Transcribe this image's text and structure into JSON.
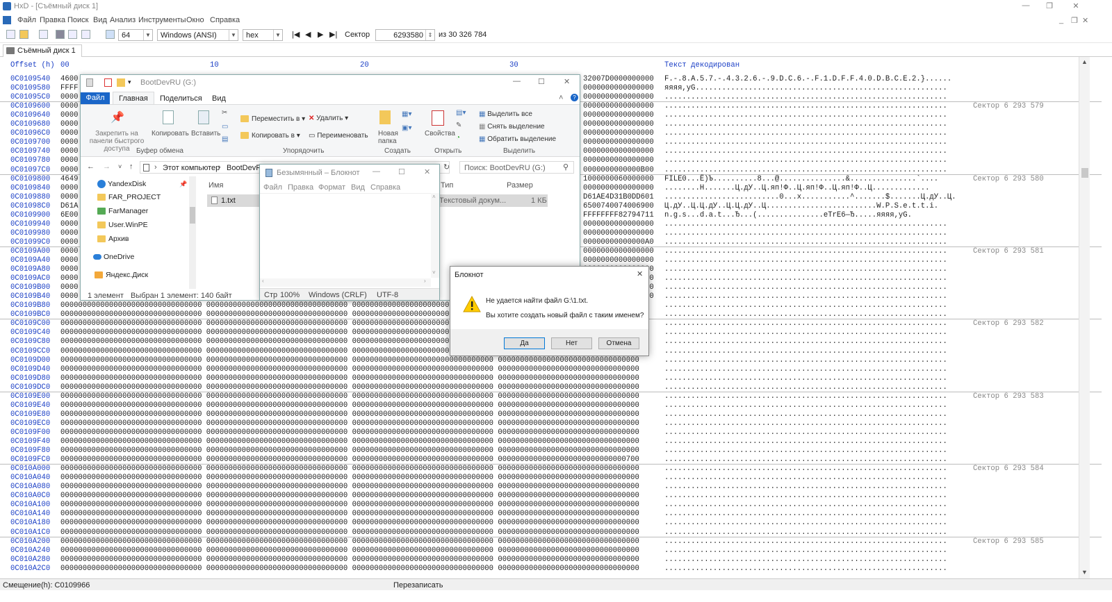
{
  "app": {
    "title": "HxD - [Съёмный диск 1]"
  },
  "menu": [
    "Файл",
    "Правка",
    "Поиск",
    "Вид",
    "Анализ",
    "Инструменты",
    "Окно",
    "Справка"
  ],
  "toolbar": {
    "bytes_per_row": "64",
    "charset": "Windows (ANSI)",
    "base": "hex",
    "sector_label": "Сектор",
    "sector_value": "6293580",
    "sector_total": "из 30 326 784"
  },
  "tab": {
    "label": "Съёмный диск 1"
  },
  "hex": {
    "header_offset": "Offset (h)",
    "header_cols": [
      "00",
      "10",
      "20",
      "30"
    ],
    "header_text": "Текст декодирован",
    "rows": [
      {
        "off": "0C0109540",
        "hex": "4600",
        "txt": "F.-.8.A.5.7.-.4.3.2.6.-.9.D.C.6.-.F.1.D.F.F.4.0.D.B.C.E.2.}......",
        "sec": ""
      },
      {
        "off": "0C0109580",
        "hex": "FFFF",
        "txt": "яяяя,yG.........................................................",
        "sec": ""
      },
      {
        "off": "0C01095C0",
        "hex": "0000",
        "txt": "................................................................",
        "sec": ""
      },
      {
        "off": "0C0109600",
        "hex": "0000",
        "txt": "................................................................",
        "sec": "Сектор 6 293 579"
      },
      {
        "off": "0C0109640",
        "hex": "0000",
        "txt": "................................................................",
        "sec": ""
      },
      {
        "off": "0C0109680",
        "hex": "0000",
        "txt": "................................................................",
        "sec": ""
      },
      {
        "off": "0C01096C0",
        "hex": "0000",
        "txt": "................................................................",
        "sec": ""
      },
      {
        "off": "0C0109700",
        "hex": "0000",
        "txt": "................................................................",
        "sec": ""
      },
      {
        "off": "0C0109740",
        "hex": "0000",
        "txt": "................................................................",
        "sec": ""
      },
      {
        "off": "0C0109780",
        "hex": "0000",
        "txt": "................................................................",
        "sec": ""
      },
      {
        "off": "0C01097C0",
        "hex": "0000",
        "txt": "................................................................",
        "sec": ""
      },
      {
        "off": "0C0109800",
        "hex": "4649",
        "txt": "FILE0...Ё)Ъ..........8...@...............&...............`....",
        "sec": "Сектор 6 293 580"
      },
      {
        "off": "0C0109840",
        "hex": "0000",
        "txt": "........Н.......Ц.дУ..Ц.яп!Ф..Ц.яп!Ф..Ц.яп!Ф..Ц.............",
        "sec": ""
      },
      {
        "off": "0C0109880",
        "hex": "0000",
        "txt": "..........................0...х...........^.......$.......Ц.дУ..Ц.",
        "sec": ""
      },
      {
        "off": "0C01098C0",
        "hex": "D61A",
        "txt": "Ц.дУ..Ц.Ц.дУ..Ц.Ц.дУ..Ц.........................W.P.S.e.t.t.i.",
        "sec": ""
      },
      {
        "off": "0C0109900",
        "hex": "6E00",
        "txt": "n.g.s...d.a.t...Ђ...(...............eTrЕ6—Ђ.....яяяя,yG.",
        "sec": ""
      },
      {
        "off": "0C0109940",
        "hex": "0000",
        "txt": "................................................................",
        "sec": ""
      },
      {
        "off": "0C0109980",
        "hex": "0000",
        "txt": "................................................................",
        "sec": ""
      },
      {
        "off": "0C01099C0",
        "hex": "0000",
        "txt": "................................................................",
        "sec": ""
      },
      {
        "off": "0C0109A00",
        "hex": "0000",
        "txt": "................................................................",
        "sec": "Сектор 6 293 581"
      },
      {
        "off": "0C0109A40",
        "hex": "0000",
        "txt": "................................................................",
        "sec": ""
      },
      {
        "off": "0C0109A80",
        "hex": "0000",
        "txt": "................................................................",
        "sec": ""
      },
      {
        "off": "0C0109AC0",
        "hex": "0000",
        "txt": "................................................................",
        "sec": ""
      },
      {
        "off": "0C0109B00",
        "hex": "0000",
        "txt": "................................................................",
        "sec": ""
      },
      {
        "off": "0C0109B40",
        "hex": "0000",
        "txt": "................................................................",
        "sec": ""
      },
      {
        "off": "0C0109B80",
        "hex": "00000000000000000000000000000000 00000000000000000000000000000000 00000000000000000000000000000000 00000000000000000000000000000000",
        "txt": "................................................................",
        "sec": ""
      },
      {
        "off": "0C0109BC0",
        "hex": "00000000000000000000000000000000 00000000000000000000000000000000 00000000000000000000000000000000 00000000000000000000000000000000",
        "txt": "................................................................",
        "sec": ""
      },
      {
        "off": "0C0109C00",
        "hex": "00000000000000000000000000000000 00000000000000000000000000000000 00000000000000000000000000000000 00000000000000000000000000000000",
        "txt": "................................................................",
        "sec": "Сектор 6 293 582"
      },
      {
        "off": "0C0109C40",
        "hex": "00000000000000000000000000000000 00000000000000000000000000000000 00000000000000000000000000000000 00000000000000000000000000000000",
        "txt": "................................................................",
        "sec": ""
      },
      {
        "off": "0C0109C80",
        "hex": "00000000000000000000000000000000 00000000000000000000000000000000 00000000000000000000000000000000 00000000000000000000000000000000",
        "txt": "................................................................",
        "sec": ""
      },
      {
        "off": "0C0109CC0",
        "hex": "00000000000000000000000000000000 00000000000000000000000000000000 00000000000000000000000000000000 00000000000000000000000000000000",
        "txt": "................................................................",
        "sec": ""
      },
      {
        "off": "0C0109D00",
        "hex": "00000000000000000000000000000000 00000000000000000000000000000000 00000000000000000000000000000000 00000000000000000000000000000000",
        "txt": "................................................................",
        "sec": ""
      },
      {
        "off": "0C0109D40",
        "hex": "00000000000000000000000000000000 00000000000000000000000000000000 00000000000000000000000000000000 00000000000000000000000000000000",
        "txt": "................................................................",
        "sec": ""
      },
      {
        "off": "0C0109D80",
        "hex": "00000000000000000000000000000000 00000000000000000000000000000000 00000000000000000000000000000000 00000000000000000000000000000000",
        "txt": "................................................................",
        "sec": ""
      },
      {
        "off": "0C0109DC0",
        "hex": "00000000000000000000000000000000 00000000000000000000000000000000 00000000000000000000000000000000 00000000000000000000000000000000",
        "txt": "................................................................",
        "sec": ""
      },
      {
        "off": "0C0109E00",
        "hex": "00000000000000000000000000000000 00000000000000000000000000000000 00000000000000000000000000000000 00000000000000000000000000000000",
        "txt": "................................................................",
        "sec": "Сектор 6 293 583"
      },
      {
        "off": "0C0109E40",
        "hex": "00000000000000000000000000000000 00000000000000000000000000000000 00000000000000000000000000000000 00000000000000000000000000000000",
        "txt": "................................................................",
        "sec": ""
      },
      {
        "off": "0C0109E80",
        "hex": "00000000000000000000000000000000 00000000000000000000000000000000 00000000000000000000000000000000 00000000000000000000000000000000",
        "txt": "................................................................",
        "sec": ""
      },
      {
        "off": "0C0109EC0",
        "hex": "00000000000000000000000000000000 00000000000000000000000000000000 00000000000000000000000000000000 00000000000000000000000000000000",
        "txt": "................................................................",
        "sec": ""
      },
      {
        "off": "0C0109F00",
        "hex": "00000000000000000000000000000000 00000000000000000000000000000000 00000000000000000000000000000000 00000000000000000000000000000000",
        "txt": "................................................................",
        "sec": ""
      },
      {
        "off": "0C0109F40",
        "hex": "00000000000000000000000000000000 00000000000000000000000000000000 00000000000000000000000000000000 00000000000000000000000000000000",
        "txt": "................................................................",
        "sec": ""
      },
      {
        "off": "0C0109F80",
        "hex": "00000000000000000000000000000000 00000000000000000000000000000000 00000000000000000000000000000000 00000000000000000000000000000000",
        "txt": "................................................................",
        "sec": ""
      },
      {
        "off": "0C0109FC0",
        "hex": "00000000000000000000000000000000 00000000000000000000000000000000 00000000000000000000000000000000 00000000000000000000000000000700",
        "txt": "................................................................",
        "sec": ""
      },
      {
        "off": "0C010A000",
        "hex": "00000000000000000000000000000000 00000000000000000000000000000000 00000000000000000000000000000000 00000000000000000000000000000000",
        "txt": "................................................................",
        "sec": "Сектор 6 293 584"
      },
      {
        "off": "0C010A040",
        "hex": "00000000000000000000000000000000 00000000000000000000000000000000 00000000000000000000000000000000 00000000000000000000000000000000",
        "txt": "................................................................",
        "sec": ""
      },
      {
        "off": "0C010A080",
        "hex": "00000000000000000000000000000000 00000000000000000000000000000000 00000000000000000000000000000000 00000000000000000000000000000000",
        "txt": "................................................................",
        "sec": ""
      },
      {
        "off": "0C010A0C0",
        "hex": "00000000000000000000000000000000 00000000000000000000000000000000 00000000000000000000000000000000 00000000000000000000000000000000",
        "txt": "................................................................",
        "sec": ""
      },
      {
        "off": "0C010A100",
        "hex": "00000000000000000000000000000000 00000000000000000000000000000000 00000000000000000000000000000000 00000000000000000000000000000000",
        "txt": "................................................................",
        "sec": ""
      },
      {
        "off": "0C010A140",
        "hex": "00000000000000000000000000000000 00000000000000000000000000000000 00000000000000000000000000000000 00000000000000000000000000000000",
        "txt": "................................................................",
        "sec": ""
      },
      {
        "off": "0C010A180",
        "hex": "00000000000000000000000000000000 00000000000000000000000000000000 00000000000000000000000000000000 00000000000000000000000000000000",
        "txt": "................................................................",
        "sec": ""
      },
      {
        "off": "0C010A1C0",
        "hex": "00000000000000000000000000000000 00000000000000000000000000000000 00000000000000000000000000000000 00000000000000000000000000000000",
        "txt": "................................................................",
        "sec": ""
      },
      {
        "off": "0C010A200",
        "hex": "00000000000000000000000000000000 00000000000000000000000000000000 00000000000000000000000000000000 00000000000000000000000000000000",
        "txt": "................................................................",
        "sec": "Сектор 6 293 585"
      },
      {
        "off": "0C010A240",
        "hex": "00000000000000000000000000000000 00000000000000000000000000000000 00000000000000000000000000000000 00000000000000000000000000000000",
        "txt": "................................................................",
        "sec": ""
      },
      {
        "off": "0C010A280",
        "hex": "00000000000000000000000000000000 00000000000000000000000000000000 00000000000000000000000000000000 00000000000000000000000000000000",
        "txt": "................................................................",
        "sec": ""
      },
      {
        "off": "0C010A2C0",
        "hex": "00000000000000000000000000000000 00000000000000000000000000000000 00000000000000000000000000000000 00000000000000000000000000000000",
        "txt": "................................................................",
        "sec": ""
      }
    ],
    "overlap_right": [
      "32007D0000000000",
      "0000000000000000",
      "0000000000000000",
      "0000000000000000",
      "0000000000000000",
      "0000000000000000",
      "0000000000000000",
      "0000000000000000",
      "0000000000000000",
      "0000000000000000",
      "0000000000000B00",
      "1000000060000000",
      "0000000000000000",
      "D61AE4D31B0DD601",
      "6500740074006900",
      "FFFFFFFF82794711",
      "0000000000000000",
      "0000000000000000",
      "00000000000000A0",
      "0000000000000000",
      "0000000000000000",
      "0000000000000000",
      "0000000000000000",
      "0000000000000000",
      "0000000000000000"
    ]
  },
  "status": {
    "offset": "Смещение(h): C0109966",
    "mode": "Перезаписать"
  },
  "explorer": {
    "title": "BootDevRU (G:)",
    "ribbon_tabs": [
      "Файл",
      "Главная",
      "Поделиться",
      "Вид"
    ],
    "pin_label": "Закрепить на панели быстрого доступа",
    "copy": "Копировать",
    "paste": "Вставить",
    "grp_clipboard": "Буфер обмена",
    "move_to": "Переместить в",
    "copy_to": "Копировать в",
    "delete": "Удалить",
    "rename": "Переименовать",
    "grp_organize": "Упорядочить",
    "new_folder": "Новая папка",
    "grp_create": "Создать",
    "properties": "Свойства",
    "grp_open": "Открыть",
    "select_all": "Выделить все",
    "select_none": "Снять выделение",
    "invert": "Обратить выделение",
    "grp_select": "Выделить",
    "path_pc": "Этот компьютер",
    "path_drive": "BootDevRU",
    "search_placeholder": "Поиск: BootDevRU (G:)",
    "nav": [
      "YandexDisk",
      "FAR_PROJECT",
      "FarManager",
      "User.WinPE",
      "Архив",
      "OneDrive",
      "Яндекс.Диск"
    ],
    "col_name": "Имя",
    "col_type": "Тип",
    "col_size": "Размер",
    "file_name": "1.txt",
    "file_type": "Текстовый докум...",
    "file_size": "1 КБ",
    "status_count": "1 элемент",
    "status_sel": "Выбран 1 элемент: 140 байт"
  },
  "notepad": {
    "title": "Безымянный – Блокнот",
    "menu": [
      "Файл",
      "Правка",
      "Формат",
      "Вид",
      "Справка"
    ],
    "status_pos": "Стр",
    "zoom": "100%",
    "eol": "Windows (CRLF)",
    "enc": "UTF-8"
  },
  "dialog": {
    "title": "Блокнот",
    "line1": "Не удается найти файл G:\\1.txt.",
    "line2": "Вы хотите создать новый файл с таким именем?",
    "yes": "Да",
    "no": "Нет",
    "cancel": "Отмена"
  }
}
